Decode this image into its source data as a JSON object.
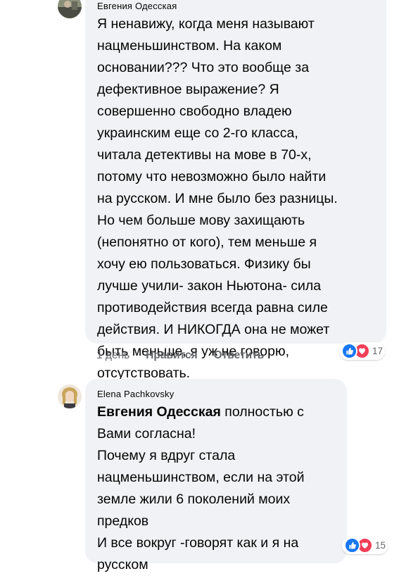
{
  "comments": [
    {
      "author": "Евгения Одесская",
      "text": "Я ненавижу, когда меня называют\nнацменьшинством. На каком\nосновании??? Что это вообще за\nдефективное выражение? Я\nсовершенно свободно владею\nукраинским еще со 2-го класса,\nчитала детективы на мове в 70-х,\nпотому что невозможно было найти\nна русском. И мне было без разницы.\nНо чем больше мову захищають\n(непонятно от кого), тем меньше я\nхочу ею пользоваться. Физику бы\nлучше учили- закон Ньютона- сила\nпротиводействия всегда равна силе\nдействия. И НИКОГДА она не может\nбыть меньше, я уж не говорю,\nотсутствовать.",
      "time": "1 день",
      "like_label": "Нравится",
      "reply_label": "Ответить",
      "reactions": {
        "count": "17",
        "icons": [
          "like-icon",
          "love-icon"
        ]
      }
    },
    {
      "author": "Elena Pachkovsky",
      "mention": "Евгения Одесская",
      "text_after_mention": "  полностью с\nВами согласна!\nПочему я вдруг стала\nнацменьшинством, если на этой\nземле жили 6 поколений моих\nпредков\nИ все вокруг -говорят как и я на\nрусском",
      "reactions": {
        "count": "15",
        "icons": [
          "like-icon",
          "love-icon"
        ]
      }
    }
  ],
  "colors": {
    "bubble": "#f0f2f5",
    "like": "#1877f2",
    "love": "#f33e58",
    "meta": "#65676b",
    "text": "#050505"
  }
}
